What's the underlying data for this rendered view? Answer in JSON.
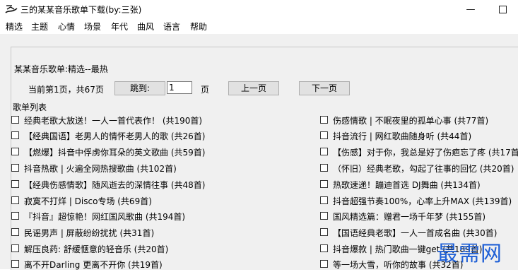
{
  "window": {
    "title": "三的某某音乐歌单下载(by:三张)",
    "minimize": "—"
  },
  "menu": [
    "精选",
    "主题",
    "心情",
    "场景",
    "年代",
    "曲风",
    "语言",
    "帮助"
  ],
  "header": {
    "heading": "某某音乐歌单:精选--最热"
  },
  "pager": {
    "info": "当前第1页，共67页",
    "jump_label": "跳到:",
    "page_value": "1",
    "page_unit": "页",
    "prev_label": "上一页",
    "next_label": "下一页"
  },
  "playlist_section_label": "歌单列表",
  "playlists_left": [
    "经典老歌大放送！一人一首代表作！ (共190首)",
    "【经典国语】老男人的情怀老男人的歌 (共26首)",
    "【燃爆】抖音中俘虏你耳朵的英文歌曲 (共59首)",
    "抖音热歌 | 火遍全网热搜歌曲 (共102首)",
    "【经典伤感情歌】随风逝去的深情往事 (共48首)",
    "寂寞不打烊 | Disco专场 (共69首)",
    "『抖音』超惊艳！网红国风歌曲 (共194首)",
    "民谣男声 | 屏蔽纷纷扰扰 (共31首)",
    "解压良药: 舒缓惬意的轻音乐 (共20首)",
    "离不开Darling 更离不开你 (共19首)"
  ],
  "playlists_right": [
    "伤感情歌 | 不眠夜里的孤单心事 (共77首)",
    "抖音流行 | 网红歌曲随身听 (共44首)",
    "【伤感】对于你，我总是好了伤疤忘了疼 (共17首)",
    "（怀旧）经典老歌，勾起了往事的回忆 (共20首)",
    "热歌速递！蹦迪首选 DJ舞曲 (共134首)",
    "抖音超强节奏100%，心率上升MAX (共139首)",
    "国风精选篇：赠君一场千年梦 (共155首)",
    "【国语经典老歌】一人一首成名曲 (共30首)",
    "抖音爆款 | 热门歌曲一键get (共189首)",
    "等一场大雪，听你的故事 (共32首)"
  ],
  "watermark": "最需网",
  "colors": {
    "window_bg": "#f0f0f0",
    "button_bg": "#e1e1e1",
    "watermark": "#1e5fd6"
  }
}
